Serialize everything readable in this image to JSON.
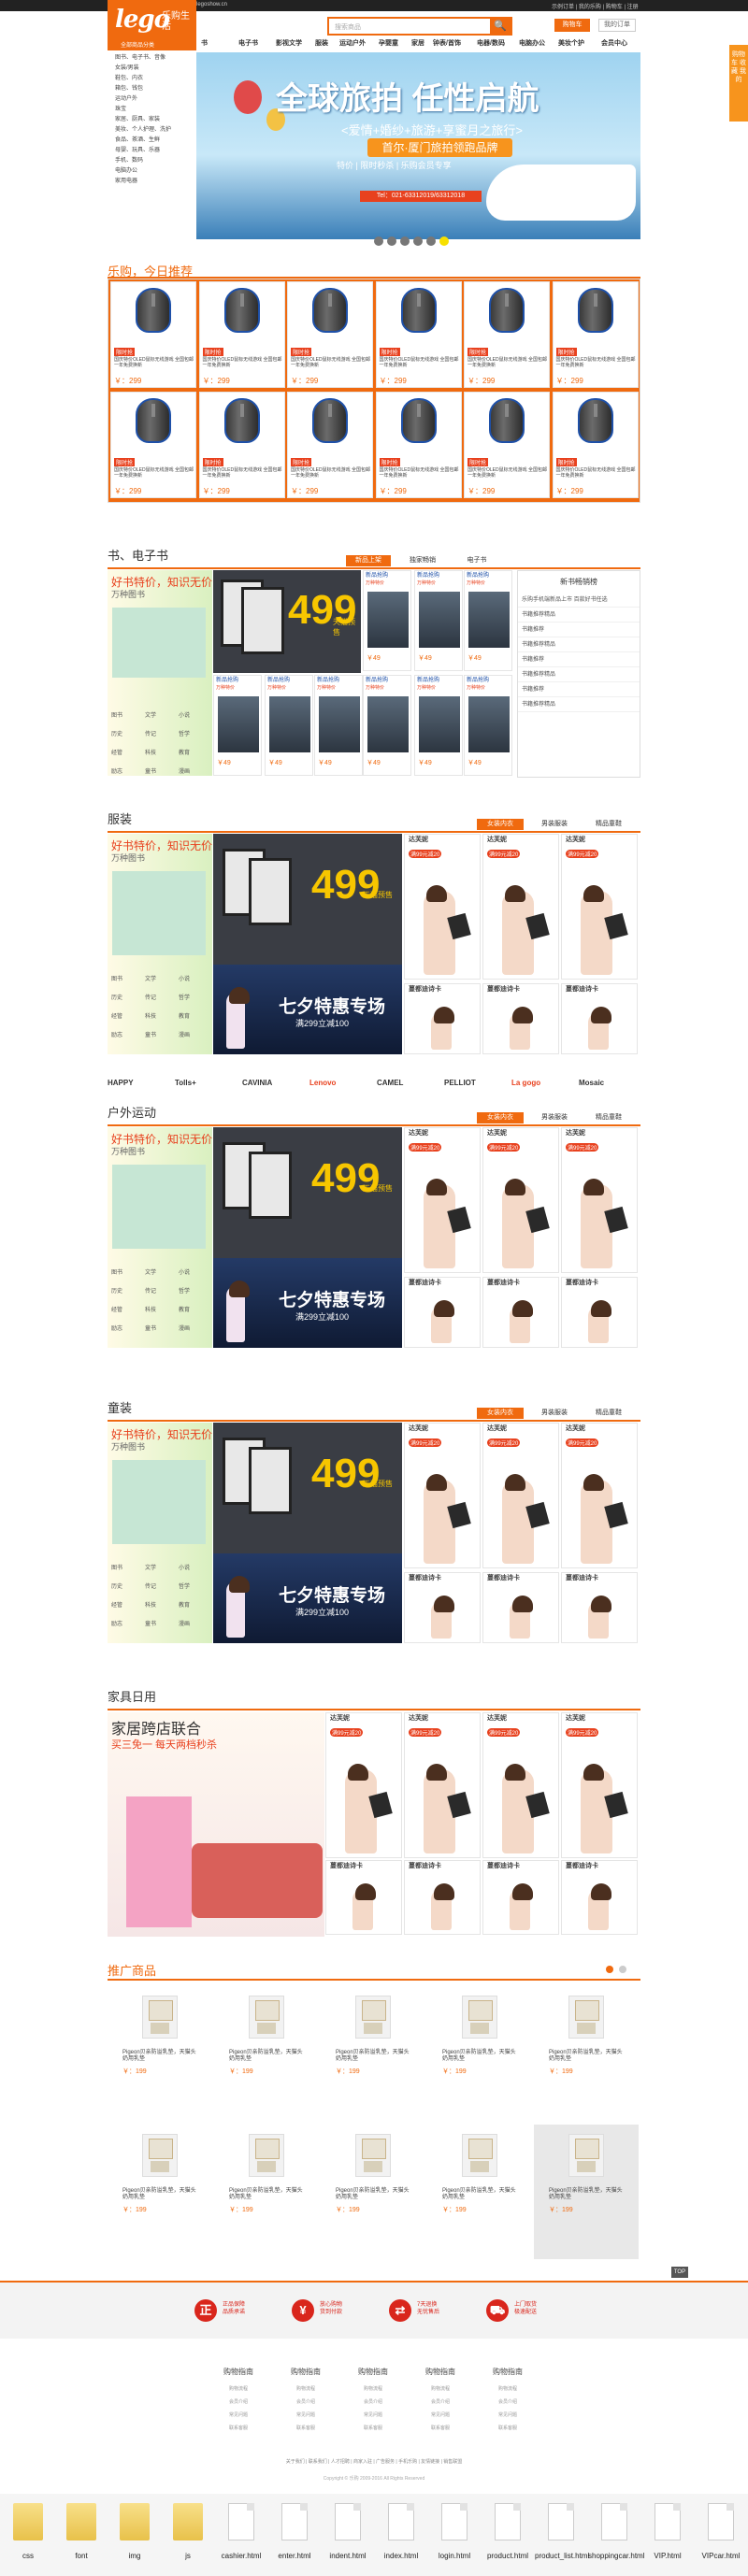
{
  "topbar": {
    "left": "legoshow.cn",
    "right": "示例订单 | 我的乐购 | 购物车 | 注册"
  },
  "logo": {
    "brand": "lego",
    "zh": "乐购生活",
    "tag": "乐购"
  },
  "search": {
    "placeholder": "搜索商品",
    "button": "🔍"
  },
  "header": {
    "cart": "购物车",
    "register": "我的订单"
  },
  "nav": [
    "书",
    "电子书",
    "影视文学",
    "服装",
    "运动户外",
    "孕婴童",
    "家居",
    "钟表/首饰",
    "电器/数码",
    "电脑办公",
    "美妆个护",
    "会员中心"
  ],
  "category_bar": "全部商品分类",
  "categories": [
    "图书、电子书、音像",
    "女装/男装",
    "鞋包、内衣",
    "箱包、钱包",
    "运动户外",
    "珠宝",
    "家居、厨具、家装",
    "美妆、个人护理、洗护",
    "食品、茶酒、生鲜",
    "母婴、玩具、乐器",
    "手机、数码",
    "电脑办公",
    "家用电器"
  ],
  "banner": {
    "title": "全球旅拍 任性启航",
    "sub": "<爱情+婚纱+旅游+享蜜月之旅行>",
    "badge": "首尔·厦门旅拍领跑品牌",
    "note": "特价 | 限时秒杀 | 乐购会员专享",
    "phone": "Tel：021-63312019/63312018"
  },
  "rec": {
    "title": "乐购，今日推荐",
    "tag": "限时抢",
    "desc": "国庆特价OLED鼠标无线游戏 全国包邮 一年免费换新",
    "price": "￥：299"
  },
  "books": {
    "title": "书、电子书",
    "tabs": [
      "新品上架",
      "独家畅销",
      "电子书"
    ],
    "promo_h": "好书特价，知识无价",
    "promo_s": "万种图书",
    "big_num": "499",
    "side": "天猫预售",
    "items": [
      "图书",
      "文学",
      "小说",
      "历史",
      "传记",
      "哲学",
      "经管",
      "科技",
      "教育",
      "励志",
      "童书",
      "漫画"
    ],
    "item_label": "新品抢购",
    "item_desc": "万种特价",
    "price": "￥49",
    "rank_title": "新书畅销榜",
    "rank": [
      "乐购手机端新品上市 百款好书任选",
      "书籍推荐精品",
      "书籍推荐",
      "书籍推荐精品",
      "书籍推荐",
      "书籍推荐精品",
      "书籍推荐",
      "书籍推荐精品"
    ]
  },
  "clothing": {
    "title": "服装",
    "tabs": [
      "女装内衣",
      "男装服装",
      "精品童鞋"
    ],
    "night": "七夕特惠专场",
    "night_sub": "满299立减100",
    "lady_h": "达芙妮",
    "lady_tag": "满99元减20",
    "lady_name": "蔓都迪诗卡"
  },
  "brands": [
    "HAPPY",
    "Tolls+",
    "CAVINIA",
    "Lenovo",
    "CAMEL",
    "PELLIOT",
    "La gogo",
    "Mosaic"
  ],
  "sports": {
    "title": "户外运动"
  },
  "kids": {
    "title": "童装"
  },
  "home": {
    "title": "家具日用",
    "promo_h": "家居跨店联合",
    "promo_s": "买三免一 每天两档秒杀"
  },
  "promoted": {
    "title": "推广商品",
    "name": "Pigeon贝亲防溢乳垫，天猫头奶用乳垫",
    "price": "￥：199"
  },
  "services": [
    {
      "icon": "正",
      "t1": "正品保障",
      "t2": "品质承诺"
    },
    {
      "icon": "¥",
      "t1": "放心购物",
      "t2": "货到付款"
    },
    {
      "icon": "⇄",
      "t1": "7天退换",
      "t2": "无忧售后"
    },
    {
      "icon": "⛟",
      "t1": "上门取货",
      "t2": "极速配送"
    }
  ],
  "footer_cols": [
    {
      "h": "购物指南",
      "items": [
        "购物流程",
        "会员介绍",
        "常见问题",
        "联系客服"
      ]
    },
    {
      "h": "购物指南",
      "items": [
        "购物流程",
        "会员介绍",
        "常见问题",
        "联系客服"
      ]
    },
    {
      "h": "购物指南",
      "items": [
        "购物流程",
        "会员介绍",
        "常见问题",
        "联系客服"
      ]
    },
    {
      "h": "购物指南",
      "items": [
        "购物流程",
        "会员介绍",
        "常见问题",
        "联系客服"
      ]
    },
    {
      "h": "购物指南",
      "items": [
        "购物流程",
        "会员介绍",
        "常见问题",
        "联系客服"
      ]
    }
  ],
  "footer_links": "关于我们 | 联系我们 | 人才招聘 | 商家入驻 | 广告服务 | 手机乐购 | 友情链接 | 销售联盟",
  "footer_copy": "Copyright ©  乐购  2009-2016  All Rights Reserved",
  "files": [
    "css",
    "font",
    "img",
    "js",
    "cashier.html",
    "enter.html",
    "indent.html",
    "index.html",
    "login.html",
    "product.html",
    "product_list.html",
    "shoppingcar.html",
    "VIP.html",
    "VIPcar.html"
  ],
  "side_widget": "购物车 收藏 我的",
  "top_arrow": "TOP"
}
